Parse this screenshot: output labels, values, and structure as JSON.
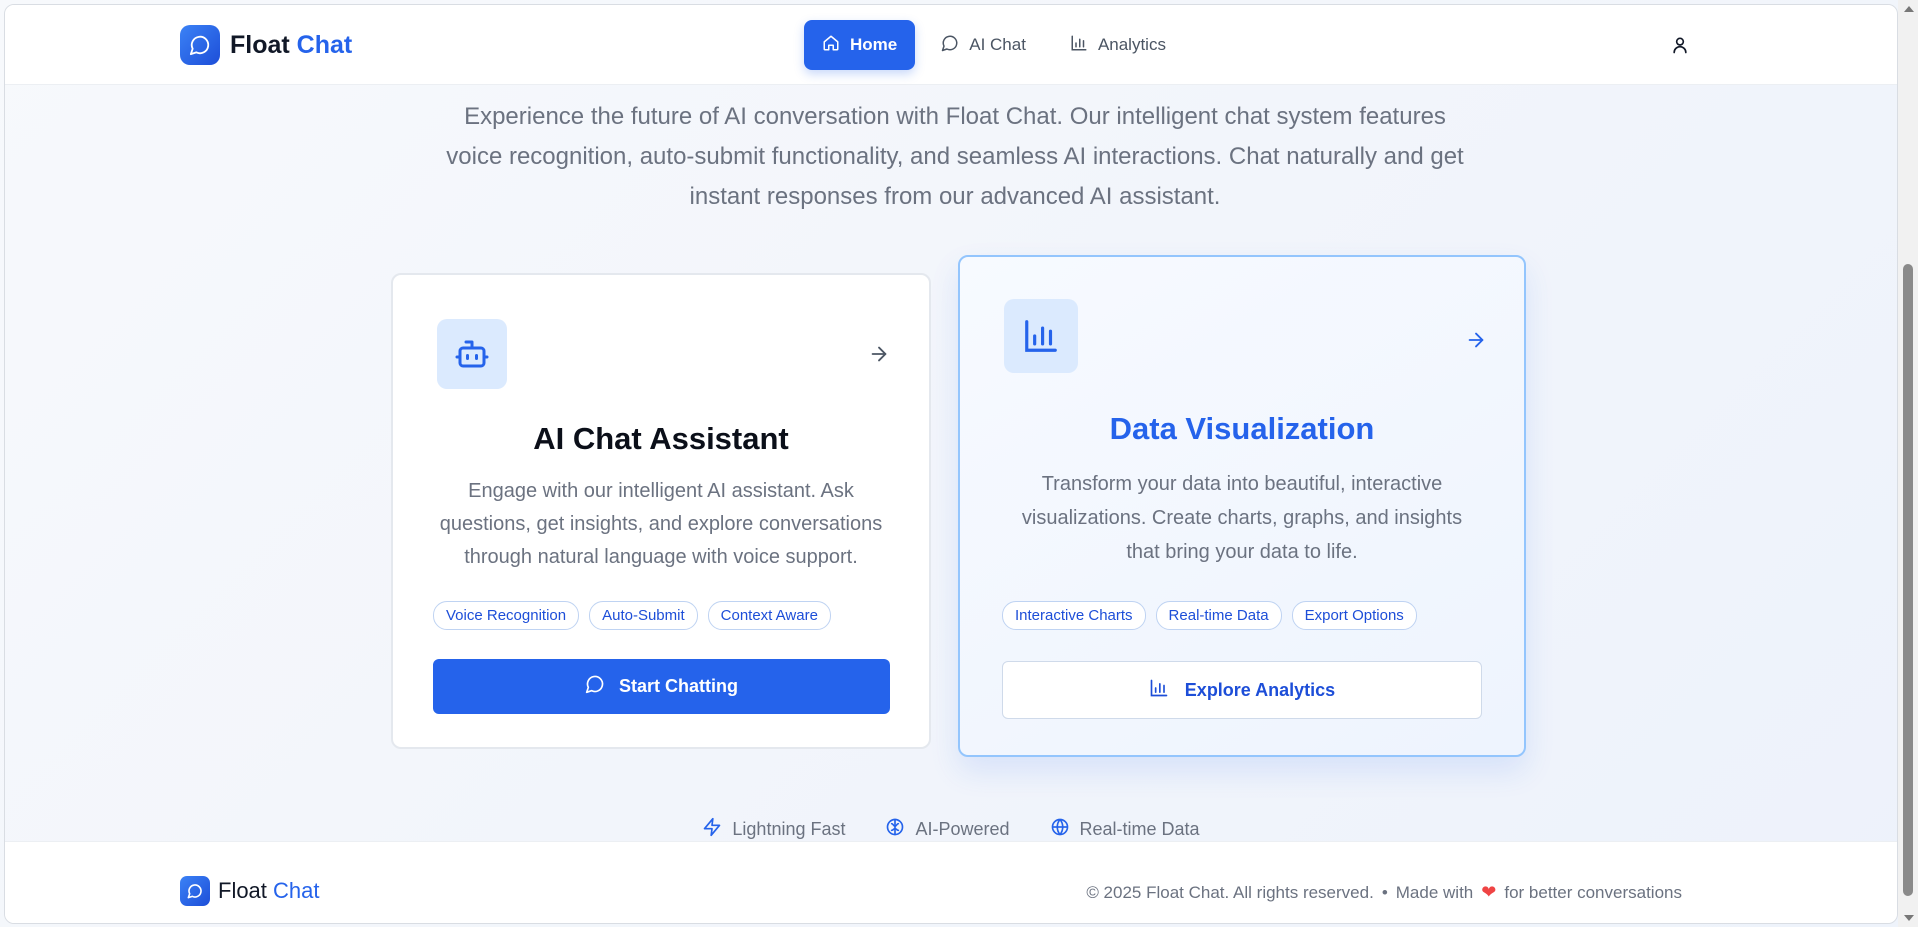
{
  "header": {
    "logo": {
      "name_part1": "Float",
      "name_part2": "Chat"
    },
    "nav": [
      {
        "label": "Home",
        "icon": "home-icon",
        "active": true
      },
      {
        "label": "AI Chat",
        "icon": "chat-bubble-icon",
        "active": false
      },
      {
        "label": "Analytics",
        "icon": "bar-chart-icon",
        "active": false
      }
    ],
    "user_icon": "user-icon"
  },
  "intro": {
    "text": "Experience the future of AI conversation with Float Chat. Our intelligent chat system features voice recognition, auto-submit functionality, and seamless AI interactions. Chat naturally and get instant responses from our advanced AI assistant."
  },
  "cards": [
    {
      "icon": "robot-icon",
      "title": "AI Chat Assistant",
      "description": "Engage with our intelligent AI assistant. Ask questions, get insights, and explore conversations through natural language with voice support.",
      "tags": [
        "Voice Recognition",
        "Auto-Submit",
        "Context Aware"
      ],
      "button": {
        "label": "Start Chatting",
        "icon": "chat-bubble-icon"
      }
    },
    {
      "icon": "bar-chart-icon",
      "title": "Data Visualization",
      "description": "Transform your data into beautiful, interactive visualizations. Create charts, graphs, and insights that bring your data to life.",
      "tags": [
        "Interactive Charts",
        "Real-time Data",
        "Export Options"
      ],
      "button": {
        "label": "Explore Analytics",
        "icon": "bar-chart-icon"
      }
    }
  ],
  "features": [
    {
      "label": "Lightning Fast",
      "icon": "lightning-icon"
    },
    {
      "label": "AI-Powered",
      "icon": "brain-icon"
    },
    {
      "label": "Real-time Data",
      "icon": "globe-icon"
    }
  ],
  "footer": {
    "logo": {
      "name_part1": "Float",
      "name_part2": "Chat"
    },
    "copyright": "© 2025 Float Chat. All rights reserved.",
    "separator": "•",
    "made_with_prefix": "Made with",
    "made_with_suffix": "for better conversations"
  },
  "colors": {
    "primary": "#2563eb",
    "accent_light": "#dbeafe",
    "heart": "#ef4444",
    "muted_text": "#6b7280"
  }
}
